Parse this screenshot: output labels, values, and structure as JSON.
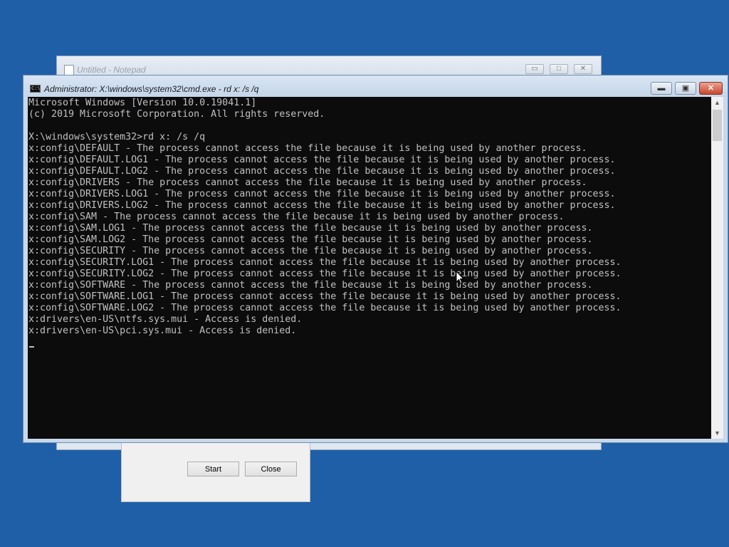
{
  "notepad": {
    "title": "Untitled - Notepad",
    "minimize_glyph": "▭",
    "maximize_glyph": "□",
    "close_glyph": "✕"
  },
  "dialog": {
    "start_label": "Start",
    "close_label": "Close"
  },
  "cmd": {
    "icon_text": "C:\\",
    "title": "Administrator: X:\\windows\\system32\\cmd.exe - rd  x: /s /q",
    "minimize_glyph": "▬",
    "maximize_glyph": "▣",
    "close_glyph": "✕",
    "lines": [
      "Microsoft Windows [Version 10.0.19041.1]",
      "(c) 2019 Microsoft Corporation. All rights reserved.",
      "",
      "X:\\windows\\system32>rd x: /s /q",
      "x:config\\DEFAULT - The process cannot access the file because it is being used by another process.",
      "x:config\\DEFAULT.LOG1 - The process cannot access the file because it is being used by another process.",
      "x:config\\DEFAULT.LOG2 - The process cannot access the file because it is being used by another process.",
      "x:config\\DRIVERS - The process cannot access the file because it is being used by another process.",
      "x:config\\DRIVERS.LOG1 - The process cannot access the file because it is being used by another process.",
      "x:config\\DRIVERS.LOG2 - The process cannot access the file because it is being used by another process.",
      "x:config\\SAM - The process cannot access the file because it is being used by another process.",
      "x:config\\SAM.LOG1 - The process cannot access the file because it is being used by another process.",
      "x:config\\SAM.LOG2 - The process cannot access the file because it is being used by another process.",
      "x:config\\SECURITY - The process cannot access the file because it is being used by another process.",
      "x:config\\SECURITY.LOG1 - The process cannot access the file because it is being used by another process.",
      "x:config\\SECURITY.LOG2 - The process cannot access the file because it is being used by another process.",
      "x:config\\SOFTWARE - The process cannot access the file because it is being used by another process.",
      "x:config\\SOFTWARE.LOG1 - The process cannot access the file because it is being used by another process.",
      "x:config\\SOFTWARE.LOG2 - The process cannot access the file because it is being used by another process.",
      "x:drivers\\en-US\\ntfs.sys.mui - Access is denied.",
      "x:drivers\\en-US\\pci.sys.mui - Access is denied."
    ],
    "scroll_up_glyph": "▲",
    "scroll_down_glyph": "▼"
  },
  "colors": {
    "desktop": "#1f5fa8",
    "console_bg": "#0c0c0c",
    "console_fg": "#c0c0c0"
  }
}
